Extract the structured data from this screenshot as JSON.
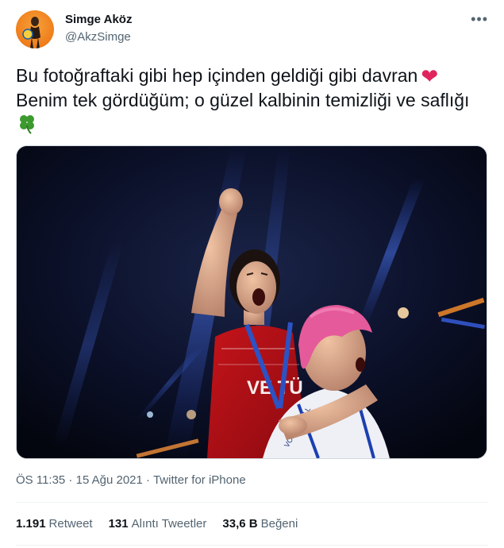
{
  "user": {
    "name": "Simge Aköz",
    "handle": "@AkzSimge"
  },
  "tweet": {
    "line1": "Bu fotoğraftaki gibi hep içinden geldiği gibi davran",
    "line2": "Benim tek gördüğüm; o güzel kalbinin temizliği ve saflığı",
    "emoji1": "heart-emoji",
    "emoji2": "four-leaf-clover-emoji"
  },
  "photo": {
    "jersey_text": "VE TÜ",
    "back_text": "VOLLEYBALL"
  },
  "meta": {
    "time": "ÖS 11:35",
    "sep1": " · ",
    "date": "15 Ağu 2021",
    "sep2": " · ",
    "source": "Twitter for iPhone"
  },
  "stats": {
    "retweets_count": "1.191",
    "retweets_label": "Retweet",
    "quotes_count": "131",
    "quotes_label": "Alıntı Tweetler",
    "likes_count": "33,6 B",
    "likes_label": "Beğeni"
  },
  "colors": {
    "text": "#0f1419",
    "secondary": "#536471",
    "heart": "#e0245e",
    "clover": "#3c9a2f"
  }
}
